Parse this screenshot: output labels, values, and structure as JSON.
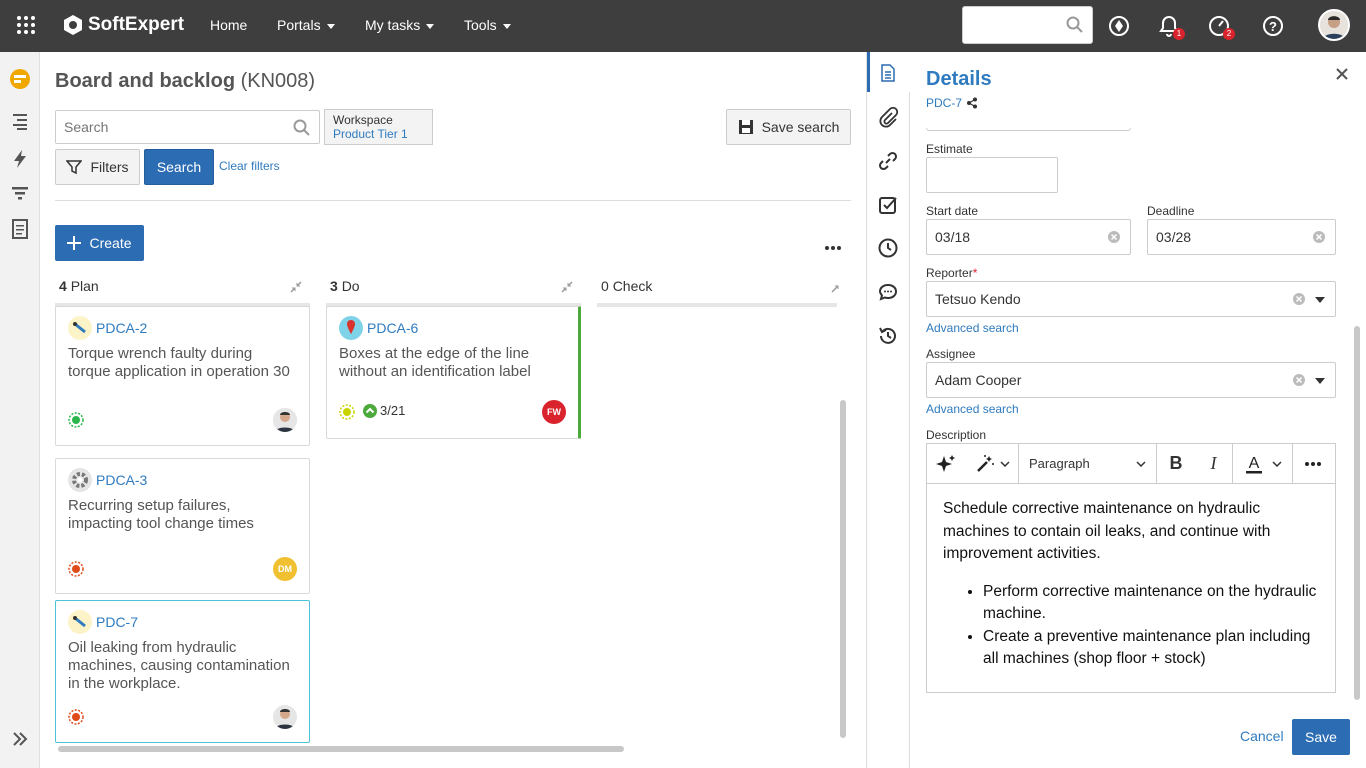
{
  "topbar": {
    "brand": "SoftExpert",
    "nav": [
      "Home",
      "Portals",
      "My tasks",
      "Tools"
    ],
    "search_placeholder": "",
    "notifications_count": "1",
    "alerts_count": "2"
  },
  "page": {
    "title": "Board and backlog",
    "code": "(KN008)",
    "search_placeholder": "Search",
    "workspace_label": "Workspace",
    "workspace_value": "Product Tier 1",
    "save_search": "Save search",
    "filters": "Filters",
    "search_button": "Search",
    "clear_filters": "Clear filters",
    "create": "Create"
  },
  "columns": [
    {
      "count": "4",
      "name": "Plan"
    },
    {
      "count": "3",
      "name": "Do"
    },
    {
      "count": "0",
      "name": "Check"
    }
  ],
  "cards": {
    "c1": {
      "id": "PDCA-2",
      "title": "Torque wrench faulty during torque application in operation 30",
      "status_color": "#2bb54a"
    },
    "c2": {
      "id": "PDCA-3",
      "title": "Recurring setup failures, impacting tool change times",
      "status_color": "#e04b1a",
      "assignee_initials": "DM"
    },
    "c3": {
      "id": "PDC-7",
      "title": "Oil leaking from hydraulic machines, causing contamination in the workplace.",
      "status_color": "#e04b1a"
    },
    "c4": {
      "id": "PDCA-6",
      "title": "Boxes at the edge of the line without an identification label",
      "status_color": "#c8d400",
      "date": "3/21",
      "assignee_initials": "FW"
    }
  },
  "details": {
    "title": "Details",
    "id": "PDC-7",
    "estimate_label": "Estimate",
    "estimate_value": "",
    "start_label": "Start date",
    "start_value": "03/18",
    "deadline_label": "Deadline",
    "deadline_value": "03/28",
    "reporter_label": "Reporter",
    "reporter_value": "Tetsuo Kendo",
    "advanced_search": "Advanced search",
    "assignee_label": "Assignee",
    "assignee_value": "Adam Cooper",
    "description_label": "Description",
    "paragraph": "Paragraph",
    "desc_text": "Schedule corrective maintenance on hydraulic machines to contain oil leaks, and continue with improvement activities.",
    "bullets": [
      "Perform corrective maintenance on the hydraulic machine.",
      "Create a preventive maintenance plan including all machines (shop floor + stock)"
    ],
    "cancel": "Cancel",
    "save": "Save"
  }
}
